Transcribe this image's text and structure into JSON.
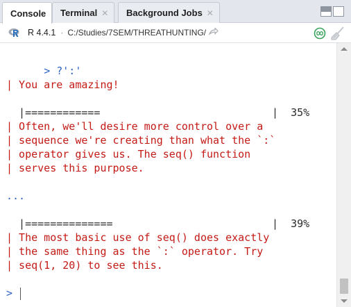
{
  "tabs": [
    {
      "label": "Console",
      "active": true,
      "closable": false
    },
    {
      "label": "Terminal",
      "active": false,
      "closable": true
    },
    {
      "label": "Background Jobs",
      "active": false,
      "closable": true
    }
  ],
  "header": {
    "r_version": "R 4.4.1",
    "separator": "·",
    "working_dir": "C:/Studies/7SEM/THREATHUNTING/"
  },
  "console": {
    "prompt_symbol": ">",
    "lines": [
      {
        "kind": "input",
        "prompt": ">",
        "text": " ?':'"
      },
      {
        "kind": "out",
        "text": "| You are amazing!"
      },
      {
        "kind": "bar",
        "text": "  |============",
        "pct": "|  35%"
      },
      {
        "kind": "out",
        "text": "| Often, we'll desire more control over a"
      },
      {
        "kind": "out",
        "text": "| sequence we're creating than what the `:`"
      },
      {
        "kind": "out",
        "text": "| operator gives us. The seq() function"
      },
      {
        "kind": "out",
        "text": "| serves this purpose."
      },
      {
        "kind": "input",
        "text": "..."
      },
      {
        "kind": "bar",
        "text": "  |==============",
        "pct": "|  39%"
      },
      {
        "kind": "out",
        "text": "| The most basic use of seq() does exactly"
      },
      {
        "kind": "out",
        "text": "| the same thing as the `:` operator. Try"
      },
      {
        "kind": "out",
        "text": "| seq(1, 20) to see this."
      },
      {
        "kind": "prompt",
        "text": ">"
      }
    ],
    "progress": [
      0.35,
      0.39
    ]
  },
  "colors": {
    "prompt": "#2f60c5",
    "output": "#c41a16",
    "text": "#2b2b2b",
    "tab_bg": "#e3e7ed"
  },
  "icons": {
    "r_logo": "r-logo-icon",
    "go_to_dir": "arrow-right-icon",
    "pane_minimize": "minimize-icon",
    "pane_maximize": "maximize-icon",
    "env_status": "infinity-circle-icon",
    "clear_console": "broom-icon"
  }
}
